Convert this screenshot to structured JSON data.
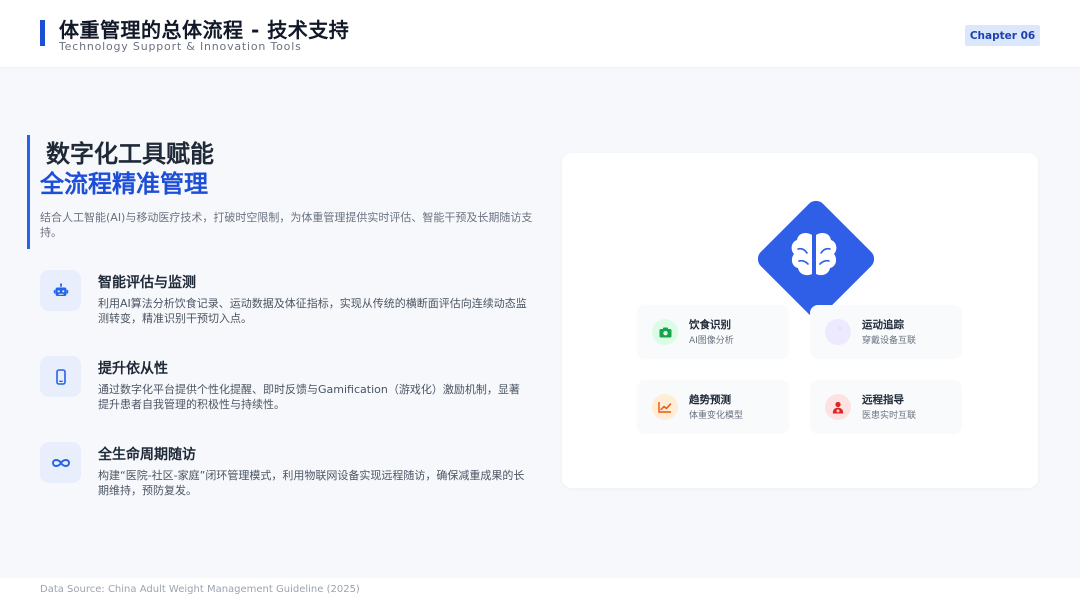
{
  "header": {
    "title": "体重管理的总体流程 - 技术支持",
    "subtitle": "Technology Support & Innovation Tools",
    "chapter": "Chapter 06"
  },
  "hero": {
    "line1": "数字化工具赋能",
    "line2": "全流程精准管理",
    "description": "结合人工智能(AI)与移动医疗技术，打破时空限制，为体重管理提供实时评估、智能干预及长期随访支持。"
  },
  "features": [
    {
      "icon": "robot-icon",
      "title": "智能评估与监测",
      "description": "利用AI算法分析饮食记录、运动数据及体征指标，实现从传统的横断面评估向连续动态监测转变，精准识别干预切入点。"
    },
    {
      "icon": "mobile-phone-icon",
      "title": "提升依从性",
      "description": "通过数字化平台提供个性化提醒、即时反馈与Gamification（游戏化）激励机制，显著提升患者自我管理的积极性与持续性。"
    },
    {
      "icon": "infinity-icon",
      "title": "全生命周期随访",
      "description": "构建“医院-社区-家庭”闭环管理模式，利用物联网设备实现远程随访，确保减重成果的长期维持，预防复发。"
    }
  ],
  "diagram": {
    "center_icon": "brain-icon",
    "tiles": [
      {
        "icon": "camera-icon",
        "title": "饮食识别",
        "subtitle": "AI图像分析",
        "color": "#16a34a",
        "bg": "#dcfce7"
      },
      {
        "icon": "running-icon",
        "title": "运动追踪",
        "subtitle": "穿戴设备互联",
        "color": "#7c3aed",
        "bg": "#ede9fe"
      },
      {
        "icon": "chart-line-icon",
        "title": "趋势预测",
        "subtitle": "体重变化模型",
        "color": "#ea580c",
        "bg": "#ffedd5"
      },
      {
        "icon": "doctor-icon",
        "title": "远程指导",
        "subtitle": "医患实时互联",
        "color": "#dc2626",
        "bg": "#fee2e2"
      }
    ]
  },
  "footer": {
    "source": "Data Source: China Adult Weight Management Guideline (2025)"
  },
  "colors": {
    "accent": "#1d4ed8",
    "diamond": "#2f5fe6",
    "chapter_bg": "#dbe7fb"
  }
}
